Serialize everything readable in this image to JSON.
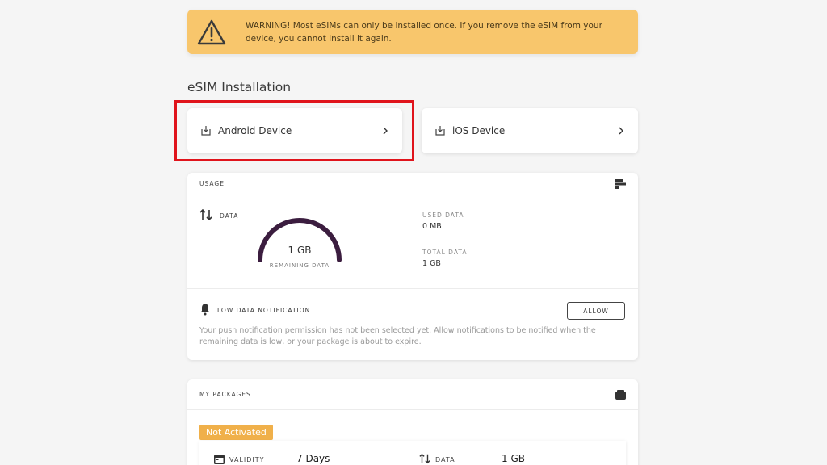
{
  "warning": {
    "text": "WARNING! Most eSIMs can only be installed once. If you remove the eSIM from your device, you cannot install it again.",
    "icon": "warning-triangle-icon",
    "bg_color": "#f8c66c"
  },
  "installation": {
    "title": "eSIM Installation",
    "android_label": "Android Device",
    "ios_label": "iOS Device"
  },
  "usage": {
    "header": "USAGE",
    "data_label": "DATA",
    "remaining_value": "1 GB",
    "remaining_label": "REMAINING DATA",
    "remaining_fraction": 1.0,
    "used_label": "USED DATA",
    "used_value": "0 MB",
    "total_label": "TOTAL DATA",
    "total_value": "1 GB",
    "gauge_color": "#3b1d3f",
    "notification_label": "LOW DATA NOTIFICATION",
    "allow_label": "ALLOW",
    "notification_text": "Your push notification permission has not been selected yet. Allow notifications to be notified when the remaining data is low, or your package is about to expire."
  },
  "packages": {
    "header": "MY PACKAGES",
    "status_badge": "Not Activated",
    "badge_color": "#f0b04a",
    "validity_label": "VALIDITY",
    "validity_value": "7 Days",
    "data_label": "DATA",
    "data_value": "1 GB"
  },
  "highlight_color": "#e0141c"
}
